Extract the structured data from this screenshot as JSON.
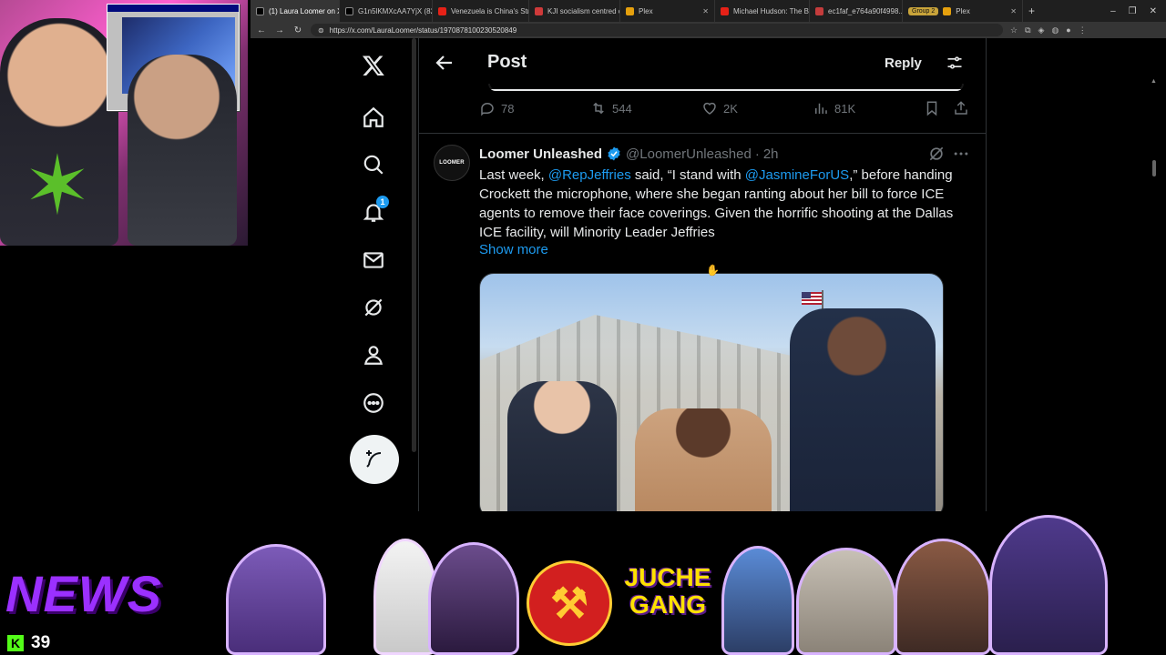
{
  "browser": {
    "tabs": [
      {
        "label": "(1) Laura Loomer on X: \"It...",
        "favicon": "x",
        "active": true
      },
      {
        "label": "G1n5lKMXcAA7YjX (823×...",
        "favicon": "x",
        "active": false
      },
      {
        "label": "Venezuela is China's Strat...",
        "favicon": "youtube",
        "active": false
      },
      {
        "label": "KJI socialism centred on ...",
        "favicon": "doc",
        "active": false
      },
      {
        "label": "Plex",
        "favicon": "plex",
        "active": false
      },
      {
        "label": "Michael Hudson: The Big...",
        "favicon": "youtube",
        "active": false
      },
      {
        "label": "ec1faf_e764a90f4998...",
        "favicon": "red",
        "active": false
      },
      {
        "label": "Plex",
        "favicon": "plex",
        "active": false,
        "group": "Group 2"
      }
    ],
    "url": "https://x.com/LauraLoomer/status/1970878100230520849",
    "new_tab": "+"
  },
  "sidebar": {
    "items": [
      {
        "name": "x-logo",
        "label": "X"
      },
      {
        "name": "home",
        "label": "Home"
      },
      {
        "name": "explore",
        "label": "Explore"
      },
      {
        "name": "notifications",
        "label": "Notifications",
        "badge": "1"
      },
      {
        "name": "messages",
        "label": "Messages"
      },
      {
        "name": "grok",
        "label": "Grok"
      },
      {
        "name": "profile",
        "label": "Profile"
      },
      {
        "name": "more",
        "label": "More"
      }
    ],
    "post_button_icon": "feather-plus-icon"
  },
  "header": {
    "title": "Post",
    "reply_label": "Reply"
  },
  "previous_post_actions": {
    "replies": "78",
    "reposts": "544",
    "likes": "2K",
    "views": "81K"
  },
  "tweet": {
    "author_name": "Loomer Unleashed",
    "avatar_text": "LOOMER",
    "handle": "@LoomerUnleashed",
    "separator": "·",
    "time": "2h",
    "body_prefix": "Last week, ",
    "mention_1": "@RepJeffries",
    "body_mid": " said, “I stand with ",
    "mention_2": "@JasmineForUS",
    "body_suffix": ",” before handing Crockett the microphone, where she began ranting about her bill to force ICE agents to remove their face coverings. Given the horrific shooting at the Dallas ICE facility, will Minority Leader Jeffries",
    "show_more": "Show more"
  },
  "overlay": {
    "news_label": "NEWS",
    "kick_logo": "K",
    "kick_viewers": "39",
    "juche_line_1": "JUCHE",
    "juche_line_2": "GANG"
  },
  "colors": {
    "accent_blue": "#1d9bf0",
    "text_primary": "#e7e9ea",
    "text_secondary": "#71767b",
    "border": "#2f3336",
    "news_purple": "#9b30ff",
    "kick_green": "#53fc18"
  }
}
